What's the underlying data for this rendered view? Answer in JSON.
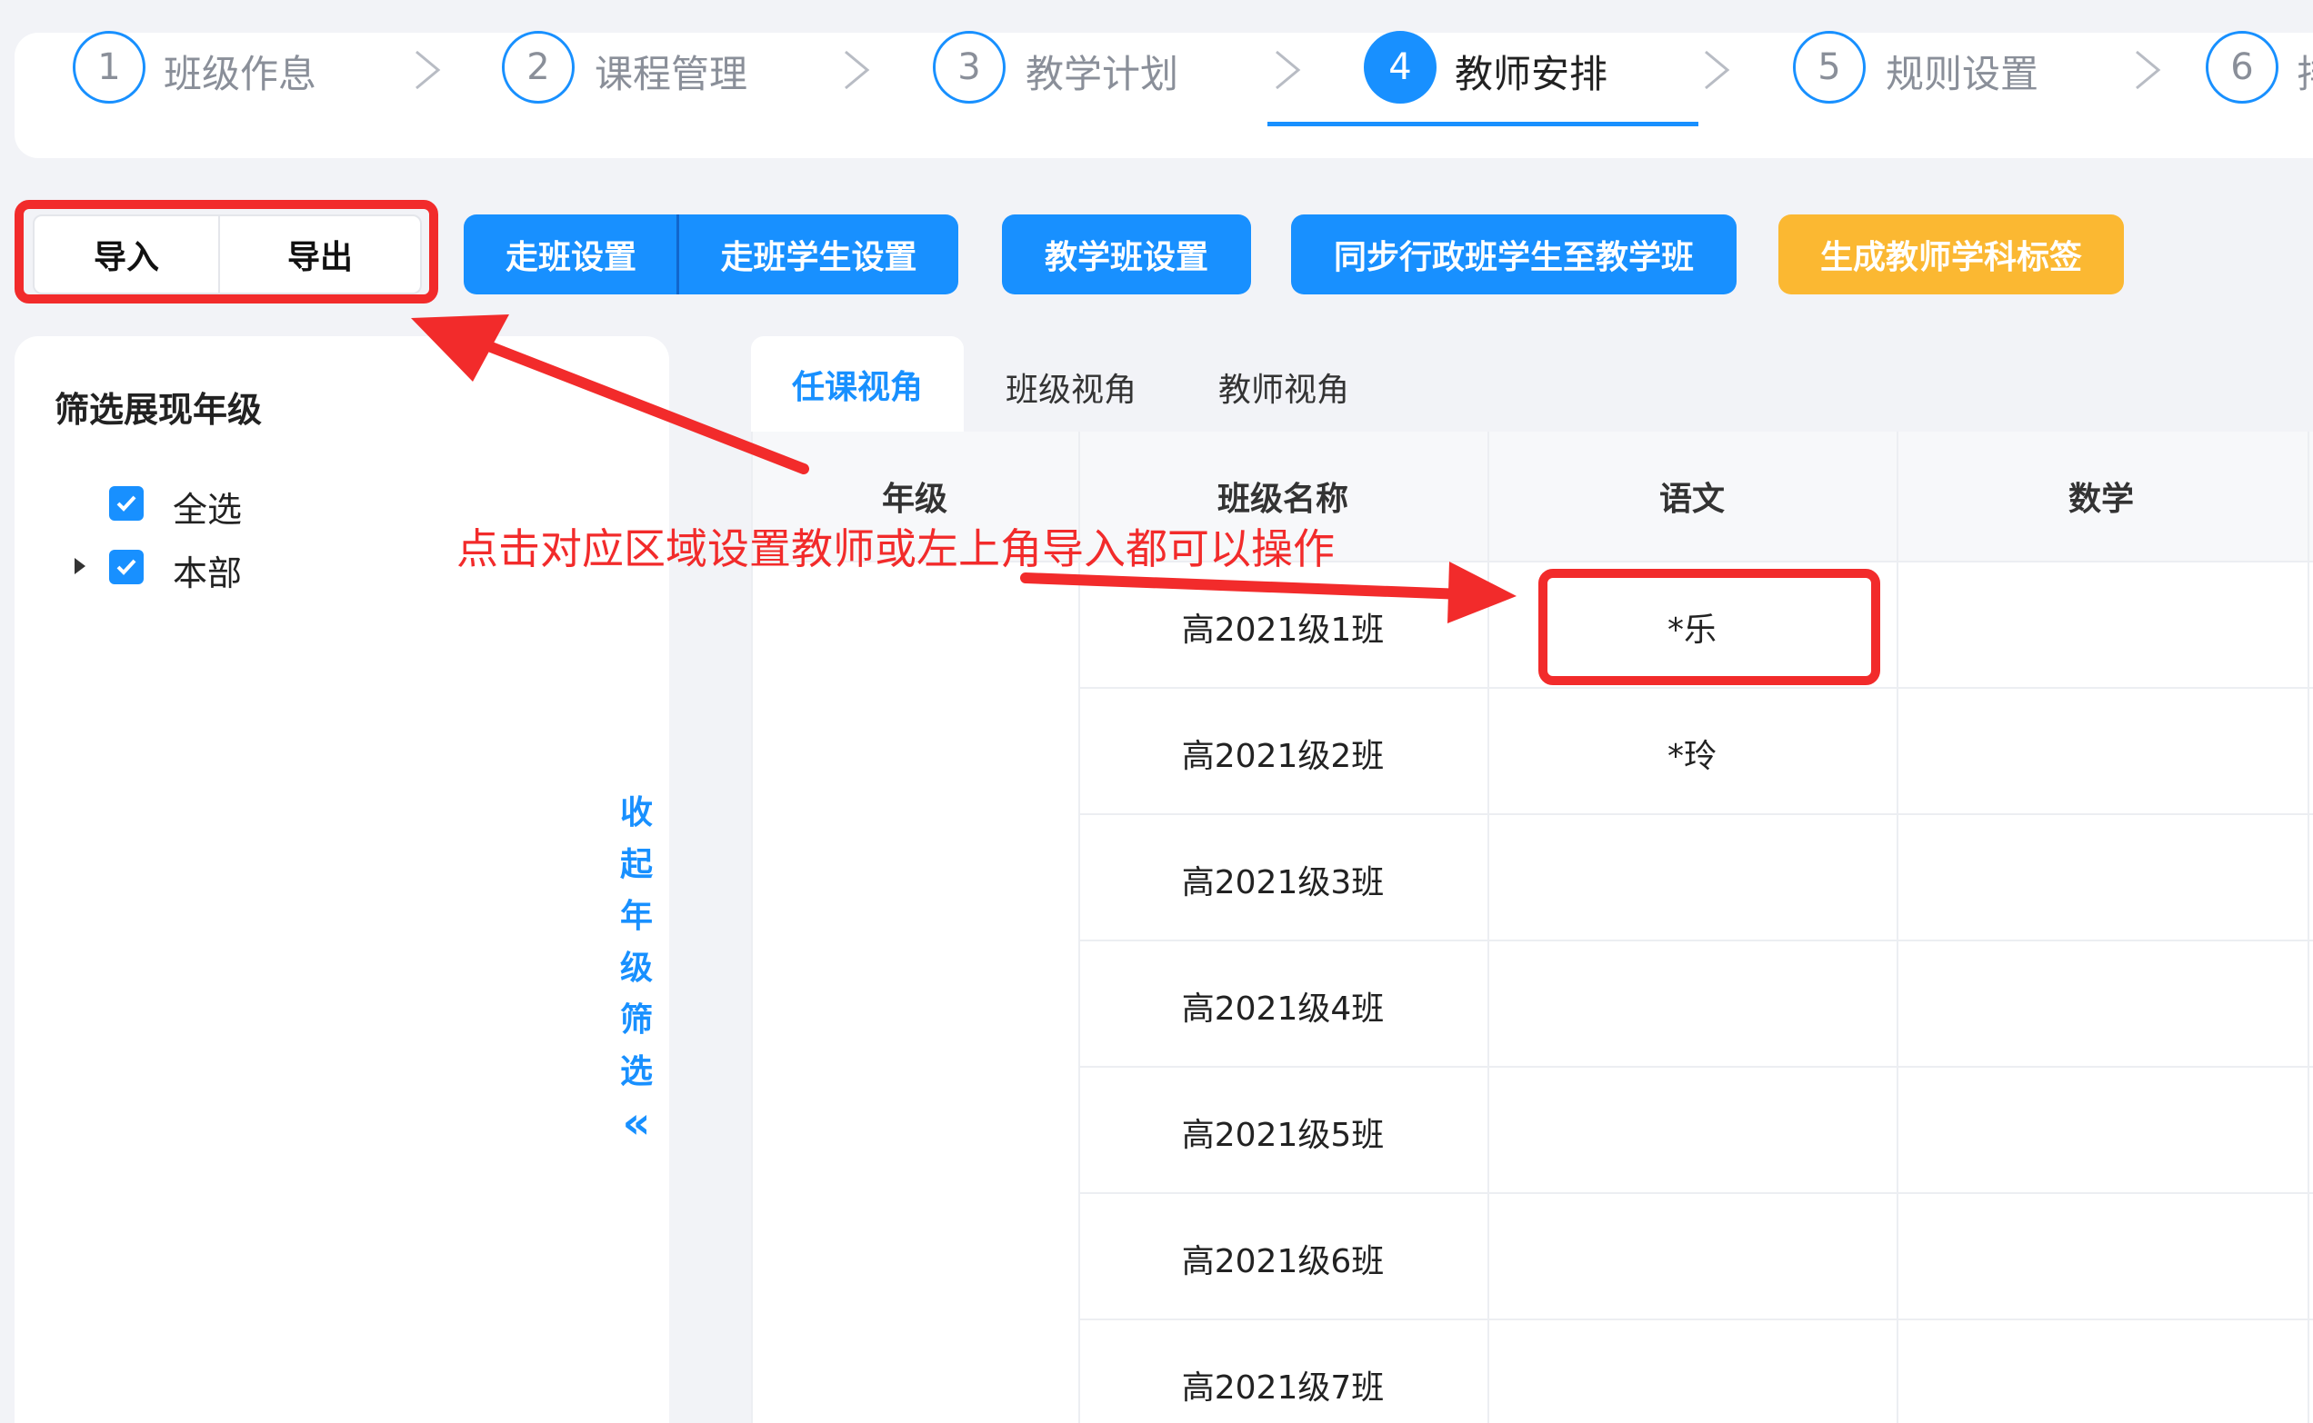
{
  "steps": [
    {
      "num": "1",
      "label": "班级作息"
    },
    {
      "num": "2",
      "label": "课程管理"
    },
    {
      "num": "3",
      "label": "教学计划"
    },
    {
      "num": "4",
      "label": "教师安排"
    },
    {
      "num": "5",
      "label": "规则设置"
    },
    {
      "num": "6",
      "label": "排"
    }
  ],
  "toolbar": {
    "import": "导入",
    "export": "导出",
    "walk_class": "走班设置",
    "walk_students": "走班学生设置",
    "teaching_class": "教学班设置",
    "sync": "同步行政班学生至教学班",
    "generate_tags": "生成教师学科标签"
  },
  "filter": {
    "title": "筛选展现年级",
    "select_all": "全选",
    "campus": "本部",
    "collapse": "收起年级筛选",
    "collapse_icon": "«"
  },
  "tabs": [
    "任课视角",
    "班级视角",
    "教师视角"
  ],
  "table": {
    "headers": [
      "年级",
      "班级名称",
      "语文",
      "数学"
    ],
    "rows": [
      {
        "class": "高2021级1班",
        "chinese": "*乐"
      },
      {
        "class": "高2021级2班",
        "chinese": "*玲"
      },
      {
        "class": "高2021级3班",
        "chinese": ""
      },
      {
        "class": "高2021级4班",
        "chinese": ""
      },
      {
        "class": "高2021级5班",
        "chinese": ""
      },
      {
        "class": "高2021级6班",
        "chinese": ""
      },
      {
        "class": "高2021级7班",
        "chinese": ""
      }
    ]
  },
  "annotation": "点击对应区域设置教师或左上角导入都可以操作",
  "colors": {
    "primary": "#1890ff",
    "orange": "#fbb832",
    "annotation_red": "#f22b2b"
  }
}
